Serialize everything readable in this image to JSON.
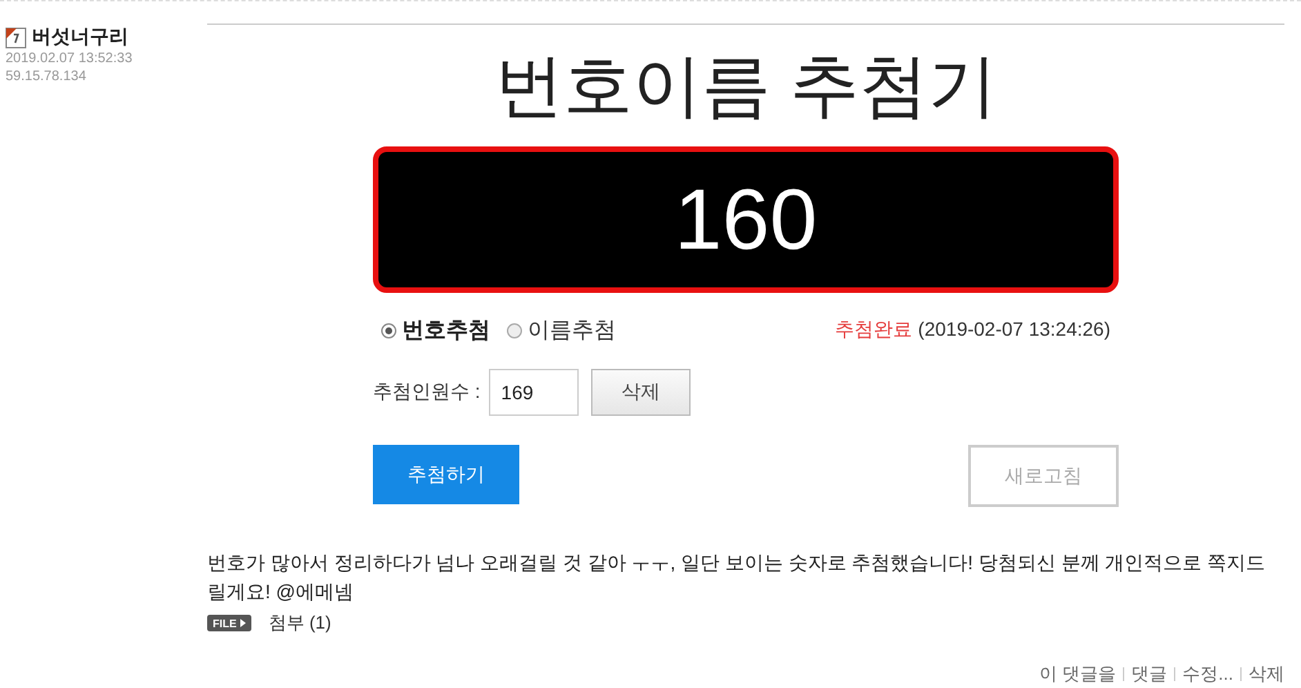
{
  "author": {
    "name": "버섯너구리",
    "date": "2019.02.07 13:52:33",
    "ip": "59.15.78.134"
  },
  "widget": {
    "title": "번호이름 추첨기",
    "result": "160",
    "modes": [
      {
        "label": "번호추첨",
        "selected": true
      },
      {
        "label": "이름추첨",
        "selected": false
      }
    ],
    "status": "추첨완료",
    "status_time": "(2019-02-07 13:24:26)",
    "count_label": "추첨인원수 :",
    "count_value": "169",
    "delete_button": "삭제",
    "draw_button": "추첨하기",
    "refresh_button": "새로고침"
  },
  "comment": {
    "text": "번호가 많아서 정리하다가 넘나 오래걸릴 것 같아 ㅜㅜ, 일단 보이는 숫자로 추첨했습니다! 당첨되신 분께 개인적으로 쪽지드릴게요! @에메넴",
    "attachment_badge": "FILE",
    "attachment": "첨부 (1)"
  },
  "actions": [
    "이 댓글을",
    "댓글",
    "수정...",
    "삭제"
  ]
}
